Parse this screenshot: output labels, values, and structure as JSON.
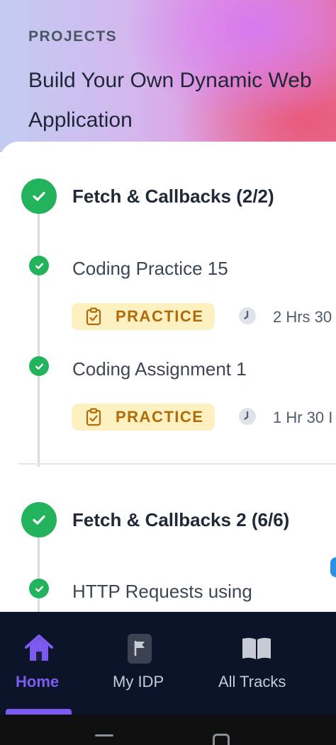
{
  "header": {
    "kicker": "PROJECTS",
    "title_line1": "Build Your Own Dynamic Web",
    "title_line2": "Application"
  },
  "sections": [
    {
      "title": "Fetch & Callbacks (2/2)",
      "status_icon": "check-circle-icon",
      "items": [
        {
          "title": "Coding Practice 15",
          "badge": "PRACTICE",
          "badge_icon": "clipboard-check-icon",
          "duration": "2 Hrs 30"
        },
        {
          "title": "Coding Assignment 1",
          "badge": "PRACTICE",
          "badge_icon": "clipboard-check-icon",
          "duration": "1 Hr 30 I"
        }
      ]
    },
    {
      "title": "Fetch & Callbacks 2 (6/6)",
      "status_icon": "check-circle-icon",
      "items": [
        {
          "title": "HTTP Requests using"
        }
      ]
    }
  ],
  "nav": {
    "items": [
      {
        "label": "Home",
        "icon": "home-icon",
        "active": true
      },
      {
        "label": "My IDP",
        "icon": "flag-document-icon",
        "active": false
      },
      {
        "label": "All Tracks",
        "icon": "open-book-icon",
        "active": false
      }
    ]
  },
  "colors": {
    "success": "#23b35c",
    "badge_bg": "#fdf1c2",
    "badge_text": "#b26a08",
    "nav_bg": "#0b1428",
    "nav_active": "#7c5cf0",
    "nav_inactive": "#c6cbd6"
  }
}
